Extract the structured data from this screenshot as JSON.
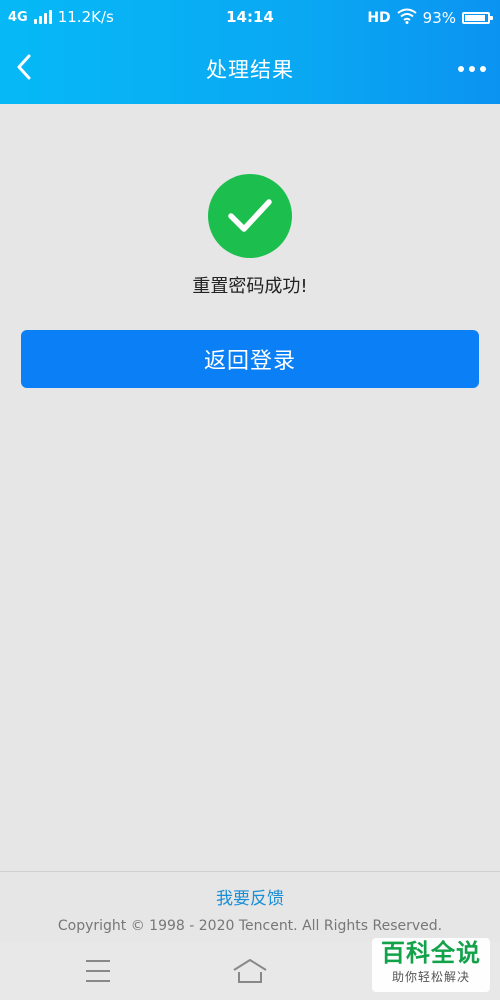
{
  "status_bar": {
    "network_type": "4G",
    "net_speed": "11.2K/s",
    "time": "14:14",
    "hd_label": "HD",
    "battery_percent": "93%",
    "battery_level": 0.93
  },
  "header": {
    "title": "处理结果",
    "back_icon": "chevron-left-icon",
    "more_icon": "more-horizontal-icon"
  },
  "result": {
    "icon": "check-circle-icon",
    "icon_color": "#1cbf4e",
    "message": "重置密码成功!"
  },
  "actions": {
    "return_login_label": "返回登录",
    "button_color": "#0b7ff5"
  },
  "footer": {
    "feedback_label": "我要反馈",
    "copyright": "Copyright © 1998 - 2020 Tencent. All Rights Reserved."
  },
  "nav_bar": {
    "menu_icon": "menu-icon",
    "home_icon": "home-icon"
  },
  "watermark": {
    "main": "百科全说",
    "sub": "助你轻松解决"
  }
}
